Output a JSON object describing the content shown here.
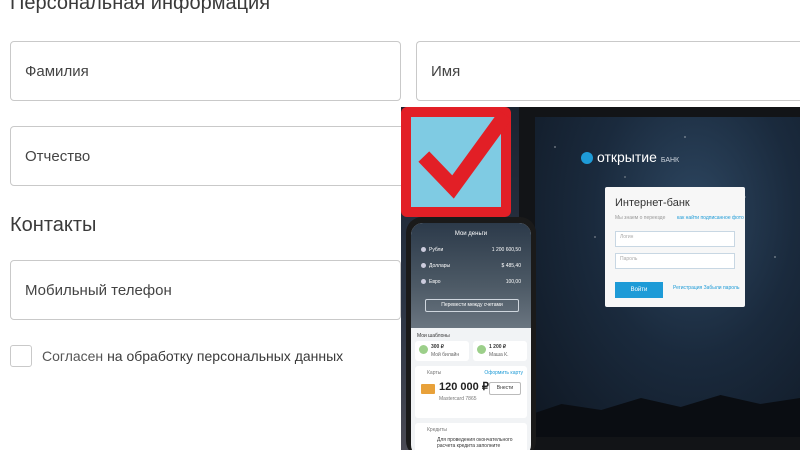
{
  "personal": {
    "title": "Персональная информация",
    "last_name_placeholder": "Фамилия",
    "first_name_placeholder": "Имя",
    "patronymic_placeholder": "Отчество"
  },
  "contacts": {
    "title": "Контакты",
    "phone_placeholder": "Мобильный телефон"
  },
  "consent": {
    "prefix": "Согласен ",
    "link": "на обработку персональных данных",
    "checked": false
  },
  "promo": {
    "bank_name": "открытие",
    "bank_sub": "БАНК",
    "login_title": "Интернет-банк",
    "login_hint": "Мы знаем о переезде",
    "login_link": "как найти подписанное фото",
    "login_field": "Логин",
    "password_field": "Пароль",
    "login_button": "Войти",
    "register_link": "Регистрация  Забыли пароль",
    "phone_title": "Мои деньги",
    "phone_accounts": [
      {
        "name": "Рубли",
        "amount": "1 200 600,50"
      },
      {
        "name": "Доллары",
        "amount": "$ 485,40"
      },
      {
        "name": "Евро",
        "amount": "100,00"
      }
    ],
    "phone_transfer": "Перевести между счетами",
    "phone_templates_title": "Мои шаблоны",
    "phone_templates": [
      {
        "amount": "300 ₽",
        "name": "Мой билайн"
      },
      {
        "amount": "1 200 ₽",
        "name": "Маша К."
      }
    ],
    "card_section": "Карты",
    "card_link": "Оформить карту",
    "card_amount": "120 000 ₽",
    "card_sub": "Mastercard 7865",
    "card_button": "Внести",
    "credit_section": "Кредиты",
    "credit_text": "Для проведения окончательного расчета кредита заполните"
  },
  "colors": {
    "badge_red": "#e21f26",
    "badge_blue": "#7fcbe3",
    "bank_blue": "#1e9bd7"
  }
}
